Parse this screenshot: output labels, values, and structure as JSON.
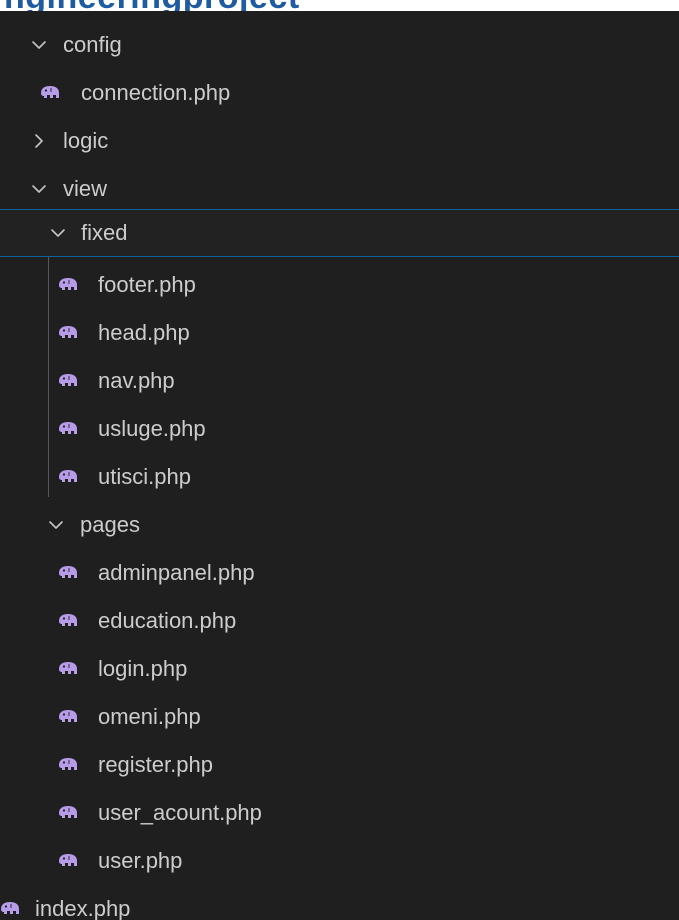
{
  "heading_fragment": "ngineeringproject",
  "explorer": {
    "config": {
      "label": "config",
      "files": [
        "connection.php"
      ]
    },
    "logic": {
      "label": "logic"
    },
    "view": {
      "label": "view",
      "fixed": {
        "label": "fixed",
        "files": [
          "footer.php",
          "head.php",
          "nav.php",
          "usluge.php",
          "utisci.php"
        ]
      },
      "pages": {
        "label": "pages",
        "files": [
          "adminpanel.php",
          "education.php",
          "login.php",
          "omeni.php",
          "register.php",
          "user_acount.php",
          "user.php"
        ]
      }
    },
    "root_files": [
      "index.php"
    ]
  },
  "icons": {
    "folder_expanded": "chevron-down-icon",
    "folder_collapsed": "chevron-right-icon",
    "php_file": "php-elephant-icon"
  },
  "colors": {
    "background": "#1f1f1f",
    "text": "#cccccc",
    "selection_border": "#0e639c",
    "indent_guide": "#585858",
    "php_icon": "#b79ce8"
  }
}
